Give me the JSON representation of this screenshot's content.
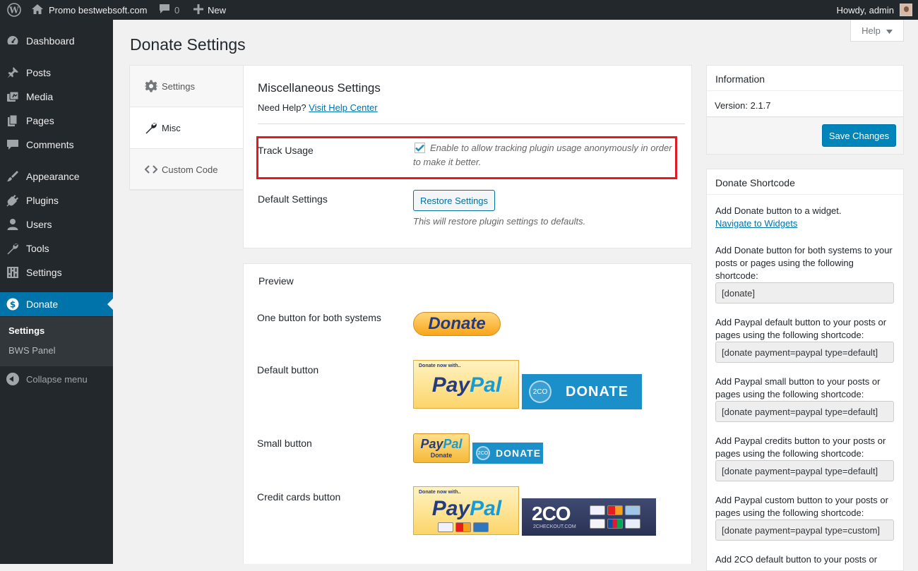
{
  "admin_bar": {
    "site_name": "Promo bestwebsoft.com",
    "comments_count": "0",
    "new_label": "New",
    "howdy": "Howdy, admin"
  },
  "sidebar": {
    "items": [
      {
        "label": "Dashboard",
        "icon": "dashboard-icon"
      },
      {
        "label": "Posts",
        "icon": "pin-icon"
      },
      {
        "label": "Media",
        "icon": "media-icon"
      },
      {
        "label": "Pages",
        "icon": "pages-icon"
      },
      {
        "label": "Comments",
        "icon": "comment-icon"
      },
      {
        "label": "Appearance",
        "icon": "brush-icon"
      },
      {
        "label": "Plugins",
        "icon": "plugin-icon"
      },
      {
        "label": "Users",
        "icon": "user-icon"
      },
      {
        "label": "Tools",
        "icon": "wrench-icon"
      },
      {
        "label": "Settings",
        "icon": "settings-icon"
      },
      {
        "label": "Donate",
        "icon": "dollar-icon"
      }
    ],
    "submenu": [
      "Settings",
      "BWS Panel"
    ],
    "collapse": "Collapse menu"
  },
  "help_tab": "Help",
  "page_title": "Donate Settings",
  "tabs": [
    {
      "label": "Settings",
      "icon": "gear-icon"
    },
    {
      "label": "Misc",
      "icon": "wrench-icon"
    },
    {
      "label": "Custom Code",
      "icon": "code-icon"
    }
  ],
  "misc": {
    "title": "Miscellaneous Settings",
    "help_prefix": "Need Help?",
    "help_link": "Visit Help Center",
    "track_label": "Track Usage",
    "track_checked": true,
    "track_desc": "Enable to allow tracking plugin usage anonymously in order to make it better.",
    "default_label": "Default Settings",
    "restore_button": "Restore Settings",
    "restore_desc": "This will restore plugin settings to defaults."
  },
  "preview": {
    "title": "Preview",
    "one_button_label": "One button for both systems",
    "donate_oval_text": "Donate",
    "default_label": "Default button",
    "small_label": "Small button",
    "credit_label": "Credit cards button",
    "paypal_small_text": "Donate now with..",
    "paypal_pay": "Pay",
    "paypal_pal": "Pal",
    "paypal_donate": "Donate",
    "co_logo": "2CO",
    "co_donate": "DONATE",
    "co_checkout": "2CHECKOUT.COM"
  },
  "info": {
    "title": "Information",
    "version_label": "Version:",
    "version": "2.1.7",
    "save_button": "Save Changes"
  },
  "shortcode": {
    "title": "Donate Shortcode",
    "widget_text": "Add Donate button to a widget.",
    "widget_link": "Navigate to Widgets",
    "entries": [
      {
        "text": "Add Donate button for both systems to your posts or pages using the following shortcode:",
        "value": "[donate]"
      },
      {
        "text": "Add Paypal default button to your posts or pages using the following shortcode:",
        "value": "[donate payment=paypal type=default]"
      },
      {
        "text": "Add Paypal small button to your posts or pages using the following shortcode:",
        "value": "[donate payment=paypal type=default]"
      },
      {
        "text": "Add Paypal credits button to your posts or pages using the following shortcode:",
        "value": "[donate payment=paypal type=default]"
      },
      {
        "text": "Add Paypal custom button to your posts or pages using the following shortcode:",
        "value": "[donate payment=paypal type=custom]"
      }
    ],
    "last_text": "Add 2CO default button to your posts or"
  },
  "colors": {
    "sidebar_bg": "#23282d",
    "active_blue": "#0073aa",
    "primary_button": "#0085ba",
    "highlight_red": "#e01b24"
  }
}
